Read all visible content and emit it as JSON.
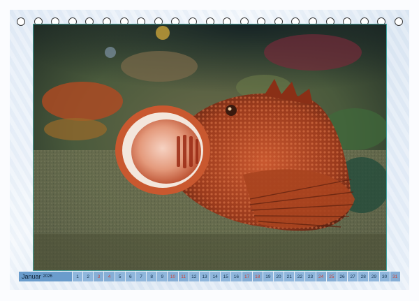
{
  "calendar": {
    "month": "Januar",
    "year": "2026",
    "days": [
      "1",
      "2",
      "3",
      "4",
      "5",
      "6",
      "7",
      "8",
      "9",
      "10",
      "11",
      "12",
      "13",
      "14",
      "15",
      "16",
      "17",
      "18",
      "19",
      "20",
      "21",
      "22",
      "23",
      "24",
      "25",
      "26",
      "27",
      "28",
      "29",
      "30",
      "31"
    ],
    "weekend_days": [
      "3",
      "4",
      "10",
      "11",
      "17",
      "18",
      "24",
      "25",
      "31"
    ]
  },
  "colors": {
    "bar": "#8fb6dc",
    "month_cell": "#6a9ccc",
    "weekend_text": "#c9453a",
    "frame": "#3fa39f"
  },
  "photo": {
    "subject": "scorpionfish-with-open-mouth"
  }
}
